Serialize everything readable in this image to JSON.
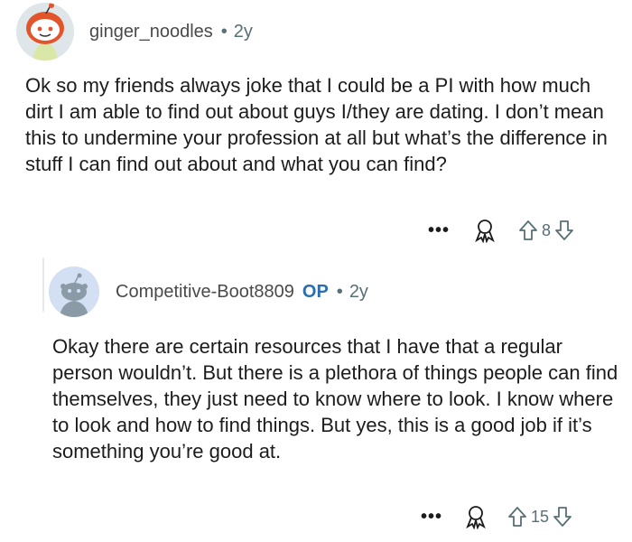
{
  "comments": [
    {
      "username": "ginger_noodles",
      "age": "2y",
      "text": "Ok so my friends always joke that I could be a PI with how much dirt I am able to find out about guys I/they are dating. I don’t mean this to undermine your profession at all but what’s the difference in stuff I can find out about and what you can find?",
      "votes": "8",
      "avatar_icon": "snoo-avatar-icon"
    },
    {
      "username": "Competitive-Boot8809",
      "op_badge": "OP",
      "age": "2y",
      "text": "Okay there are certain resources that I have that a regular person wouldn’t. But there is a plethora of things people can find themselves, they just need to know where to look. I know where to look and how to find things. But yes, this is a good job if it’s something you’re good at.",
      "votes": "15",
      "avatar_icon": "default-snoo-avatar-icon"
    }
  ],
  "actions": {
    "more_label": "•••",
    "award_icon": "award-icon",
    "upvote_icon": "upvote-arrow-icon",
    "downvote_icon": "downvote-arrow-icon"
  },
  "colors": {
    "text": "#1c1c1c",
    "meta": "#576f76",
    "op": "#2a6db0",
    "avatar_bg_2": "#d3e0f4"
  }
}
